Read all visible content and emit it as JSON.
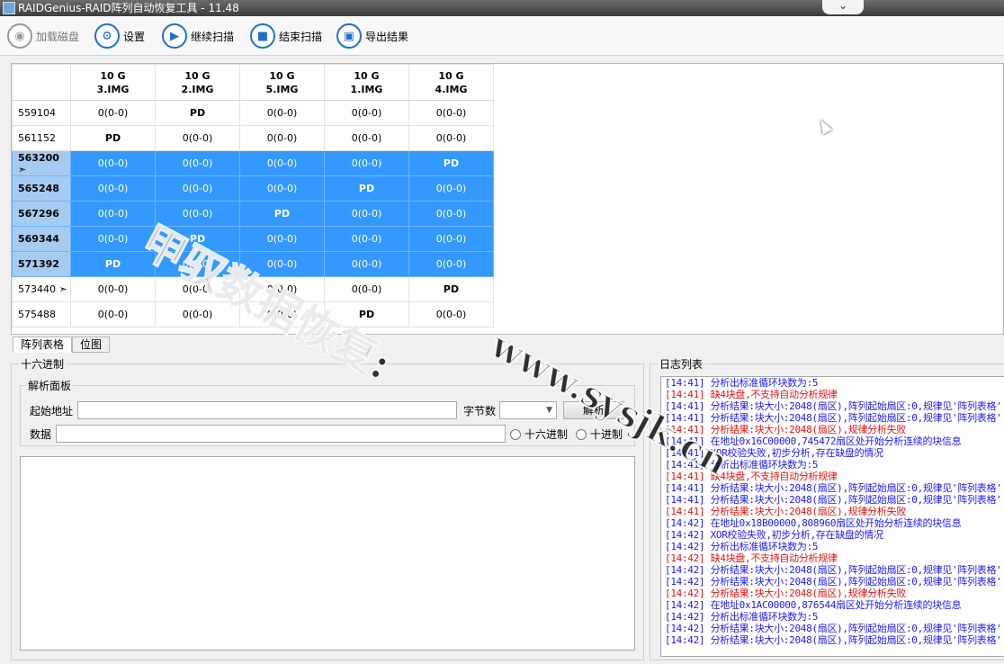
{
  "window": {
    "title": "RAIDGenius-RAID阵列自动恢复工具 - 11.48",
    "minimize_glyph": "⌄"
  },
  "toolbar": {
    "load_disk": "加载磁盘",
    "settings": "设置",
    "continue_scan": "继续扫描",
    "stop_scan": "结束扫描",
    "export_result": "导出结果"
  },
  "grid": {
    "columns": [
      {
        "size": "10 G",
        "name": "3.IMG"
      },
      {
        "size": "10 G",
        "name": "2.IMG"
      },
      {
        "size": "10 G",
        "name": "5.IMG"
      },
      {
        "size": "10 G",
        "name": "1.IMG"
      },
      {
        "size": "10 G",
        "name": "4.IMG"
      }
    ],
    "rows": [
      {
        "label": "559104",
        "cells": [
          "0(0-0)",
          "PD",
          "0(0-0)",
          "0(0-0)",
          "0(0-0)"
        ],
        "selected": false
      },
      {
        "label": "561152",
        "cells": [
          "PD",
          "0(0-0)",
          "0(0-0)",
          "0(0-0)",
          "0(0-0)"
        ],
        "selected": false
      },
      {
        "label": "563200 ➣",
        "cells": [
          "0(0-0)",
          "0(0-0)",
          "0(0-0)",
          "0(0-0)",
          "PD"
        ],
        "selected": true
      },
      {
        "label": "565248",
        "cells": [
          "0(0-0)",
          "0(0-0)",
          "0(0-0)",
          "PD",
          "0(0-0)"
        ],
        "selected": true
      },
      {
        "label": "567296",
        "cells": [
          "0(0-0)",
          "0(0-0)",
          "PD",
          "0(0-0)",
          "0(0-0)"
        ],
        "selected": true
      },
      {
        "label": "569344",
        "cells": [
          "0(0-0)",
          "PD",
          "0(0-0)",
          "0(0-0)",
          "0(0-0)"
        ],
        "selected": true
      },
      {
        "label": "571392",
        "cells": [
          "PD",
          "0(0-0)",
          "0(0-0)",
          "0(0-0)",
          "0(0-0)"
        ],
        "selected": true
      },
      {
        "label": "573440 ➣",
        "cells": [
          "0(0-0)",
          "0(0-0)",
          "0(0-0)",
          "0(0-0)",
          "PD"
        ],
        "selected": false
      },
      {
        "label": "575488",
        "cells": [
          "0(0-0)",
          "0(0-0)",
          "0(0-0)",
          "PD",
          "0(0-0)"
        ],
        "selected": false
      }
    ]
  },
  "tabs": [
    "阵列表格",
    "位图"
  ],
  "hex": {
    "title": "十六进制",
    "parse_panel": "解析面板",
    "start_addr_label": "起始地址",
    "byte_count_label": "字节数",
    "parse_button": "解析",
    "data_label": "数据",
    "radio_hex": "十六进制",
    "radio_dec": "十进制"
  },
  "log": {
    "title": "日志列表",
    "lines": [
      {
        "text": "[14:41] 分析出标准循环块数为:5",
        "color": "blue"
      },
      {
        "text": "[14:41] 缺4块盘,不支持自动分析规律",
        "color": "red"
      },
      {
        "text": "[14:41] 分析结果:块大小:2048(扇区),阵列起始扇区:0,规律见'阵列表格'",
        "color": "blue"
      },
      {
        "text": "[14:41] 分析结果:块大小:2048(扇区),阵列起始扇区:0,规律见'阵列表格'",
        "color": "blue"
      },
      {
        "text": "[14:41] 分析结果:块大小:2048(扇区),规律分析失败",
        "color": "red"
      },
      {
        "text": "[14:41] 在地址0x16C00000,745472扇区处开始分析连续的块信息",
        "color": "blue"
      },
      {
        "text": "[14:41] XOR校验失败,初步分析,存在缺盘的情况",
        "color": "blue"
      },
      {
        "text": "[14:41] 分析出标准循环块数为:5",
        "color": "blue"
      },
      {
        "text": "[14:41] 缺4块盘,不支持自动分析规律",
        "color": "red"
      },
      {
        "text": "[14:41] 分析结果:块大小:2048(扇区),阵列起始扇区:0,规律见'阵列表格'",
        "color": "blue"
      },
      {
        "text": "[14:41] 分析结果:块大小:2048(扇区),阵列起始扇区:0,规律见'阵列表格'",
        "color": "blue"
      },
      {
        "text": "[14:41] 分析结果:块大小:2048(扇区),规律分析失败",
        "color": "red"
      },
      {
        "text": "[14:42] 在地址0x18B00000,808960扇区处开始分析连续的块信息",
        "color": "blue"
      },
      {
        "text": "[14:42] XOR校验失败,初步分析,存在缺盘的情况",
        "color": "blue"
      },
      {
        "text": "[14:42] 分析出标准循环块数为:5",
        "color": "blue"
      },
      {
        "text": "[14:42] 缺4块盘,不支持自动分析规律",
        "color": "red"
      },
      {
        "text": "[14:42] 分析结果:块大小:2048(扇区),阵列起始扇区:0,规律见'阵列表格'",
        "color": "blue"
      },
      {
        "text": "[14:42] 分析结果:块大小:2048(扇区),阵列起始扇区:0,规律见'阵列表格'",
        "color": "blue"
      },
      {
        "text": "[14:42] 分析结果:块大小:2048(扇区),规律分析失败",
        "color": "red"
      },
      {
        "text": "[14:42] 在地址0x1AC00000,876544扇区处开始分析连续的块信息",
        "color": "blue"
      },
      {
        "text": "[14:42] 分析出标准循环块数为:5",
        "color": "blue"
      },
      {
        "text": "[14:42] 分析结果:块大小:2048(扇区),阵列起始扇区:0,规律见'阵列表格'",
        "color": "blue"
      },
      {
        "text": "[14:42] 分析结果:块大小:2048(扇区),阵列起始扇区:0,规律见'阵列表格'",
        "color": "blue"
      }
    ]
  },
  "watermark": {
    "line1": "甲驭数据恢复:",
    "line2": "www.sysjk.cn"
  }
}
